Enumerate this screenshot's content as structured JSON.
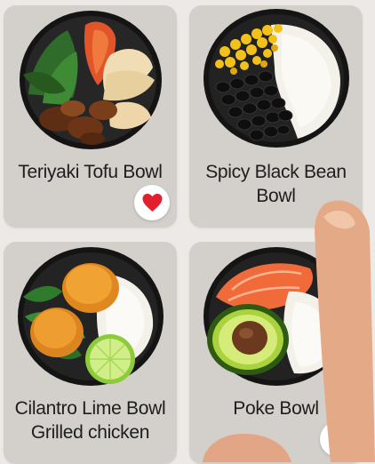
{
  "recipes": [
    {
      "title": "Teriyaki Tofu Bowl",
      "favorited": true
    },
    {
      "title": "Spicy Black Bean\nBowl",
      "favorited": false
    },
    {
      "title": "Cilantro Lime Bowl\nGrilled chicken",
      "favorited": false
    },
    {
      "title": "Poke Bowl",
      "favorited": true
    }
  ],
  "icons": {
    "favorite": "heart-icon"
  },
  "colors": {
    "favorite": "#e0202f",
    "card": "#d3cfcb",
    "bowl": "#1b1b1b"
  }
}
